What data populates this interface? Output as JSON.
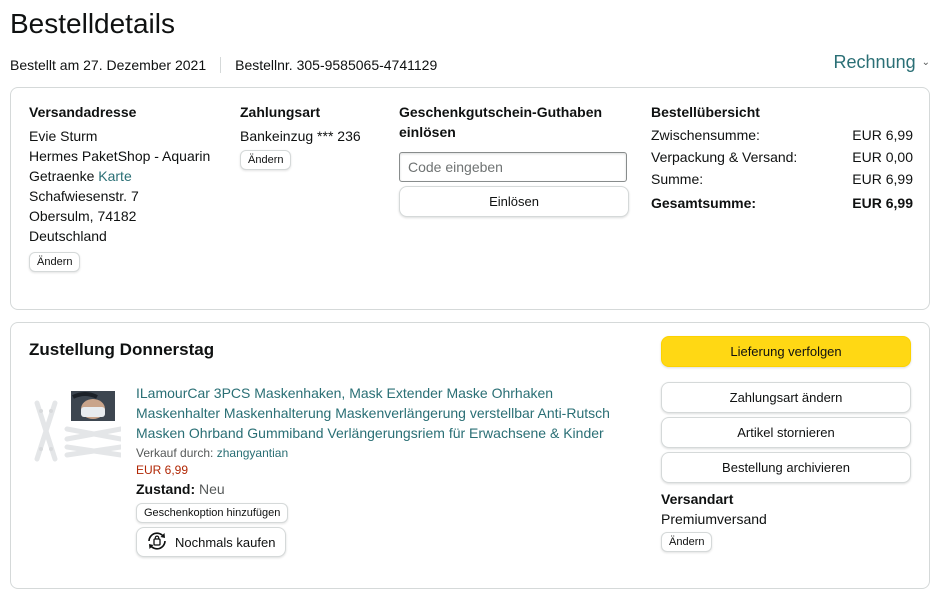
{
  "header": {
    "title": "Bestelldetails",
    "ordered_on": "Bestellt am 27. Dezember 2021",
    "order_number": "Bestellnr. 305-9585065-4741129",
    "invoice_label": "Rechnung"
  },
  "address": {
    "heading": "Versandadresse",
    "name": "Evie Sturm",
    "line1": "Hermes PaketShop - Aquarin",
    "line2_prefix": "Getraenke",
    "line2_link": "Karte",
    "street": "Schafwiesenstr. 7",
    "city": "Obersulm, 74182",
    "country": "Deutschland",
    "change_label": "Ändern"
  },
  "payment": {
    "heading": "Zahlungsart",
    "method": "Bankeinzug *** 236",
    "change_label": "Ändern"
  },
  "gift": {
    "heading": "Geschenkgutschein-Guthaben einlösen",
    "placeholder": "Code eingeben",
    "redeem_label": "Einlösen"
  },
  "summary": {
    "heading": "Bestellübersicht",
    "rows": [
      {
        "label": "Zwischensumme:",
        "value": "EUR 6,99"
      },
      {
        "label": "Verpackung & Versand:",
        "value": "EUR 0,00"
      },
      {
        "label": "Summe:",
        "value": "EUR 6,99"
      }
    ],
    "total_label": "Gesamtsumme:",
    "total_value": "EUR 6,99"
  },
  "delivery": {
    "title": "Zustellung Donnerstag",
    "product": {
      "title": "ILamourCar 3PCS Maskenhaken, Mask Extender Maske Ohrhaken Maskenhalter Maskenhalterung Maskenverlängerung verstellbar Anti-Rutsch Masken Ohrband Gummiband Verlängerungsriem für Erwachsene & Kinder",
      "seller_prefix": "Verkauf durch:",
      "seller": "zhangyantian",
      "price": "EUR 6,99",
      "condition_label": "Zustand:",
      "condition_value": "Neu",
      "gift_option_label": "Geschenkoption hinzufügen",
      "rebuy_label": "Nochmals kaufen"
    },
    "actions": {
      "track": "Lieferung verfolgen",
      "change_payment": "Zahlungsart ändern",
      "cancel": "Artikel stornieren",
      "archive": "Bestellung archivieren"
    },
    "shipping": {
      "heading": "Versandart",
      "value": "Premiumversand",
      "change_label": "Ändern"
    }
  },
  "colors": {
    "link": "#2a6f75",
    "price": "#b12704",
    "track_button": "#ffd814",
    "border": "#d5d9d9"
  }
}
